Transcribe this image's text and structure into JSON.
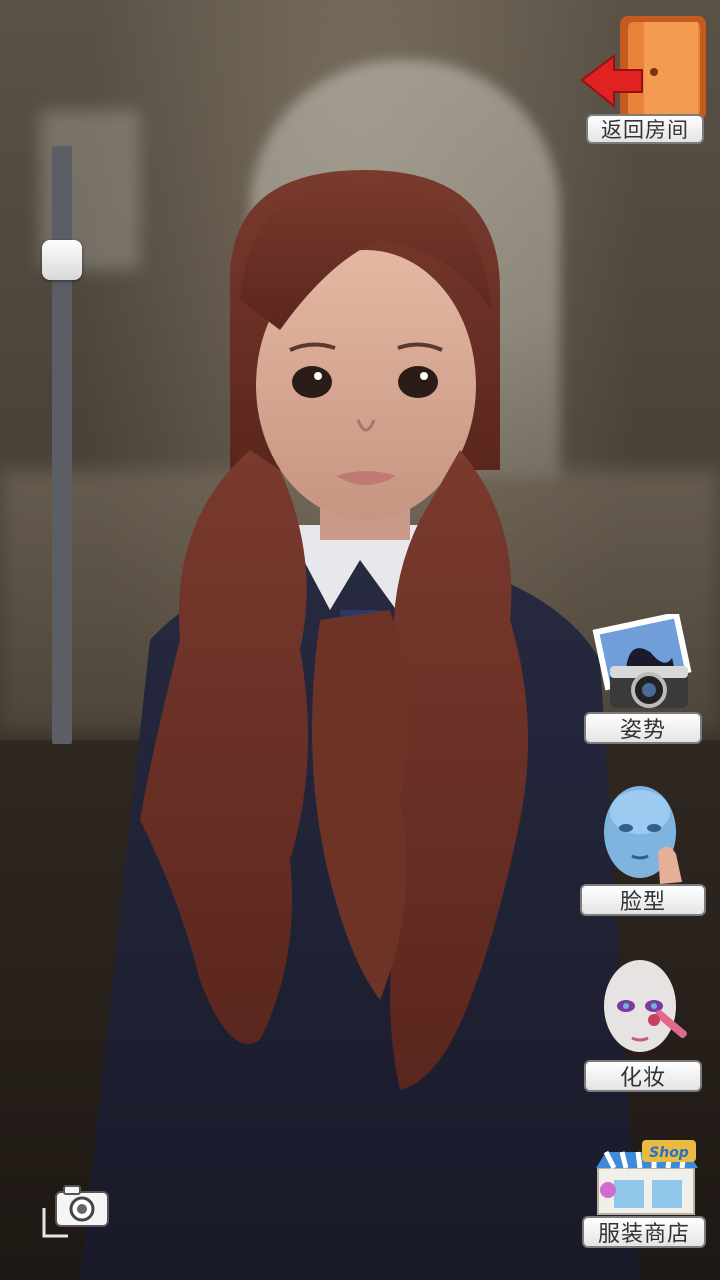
{
  "buttons": {
    "back_room": "返回房间",
    "pose": "姿势",
    "face_shape": "脸型",
    "makeup": "化妆",
    "clothing_shop": "服装商店"
  },
  "icons": {
    "back_room": "door-exit-icon",
    "pose": "camera-photo-icon",
    "face_shape": "face-shape-icon",
    "makeup": "makeup-brush-icon",
    "clothing_shop": "shop-storefront-icon",
    "screenshot": "camera-icon"
  },
  "shop_sign": "Shop",
  "zoom_slider": {
    "value": 0.19
  },
  "colors": {
    "label_bg": "#f2f2f2",
    "label_text": "#333333",
    "door": "#d9722b",
    "arrow": "#e02222",
    "hair": "#6b3026",
    "sweater": "#1f2236"
  }
}
